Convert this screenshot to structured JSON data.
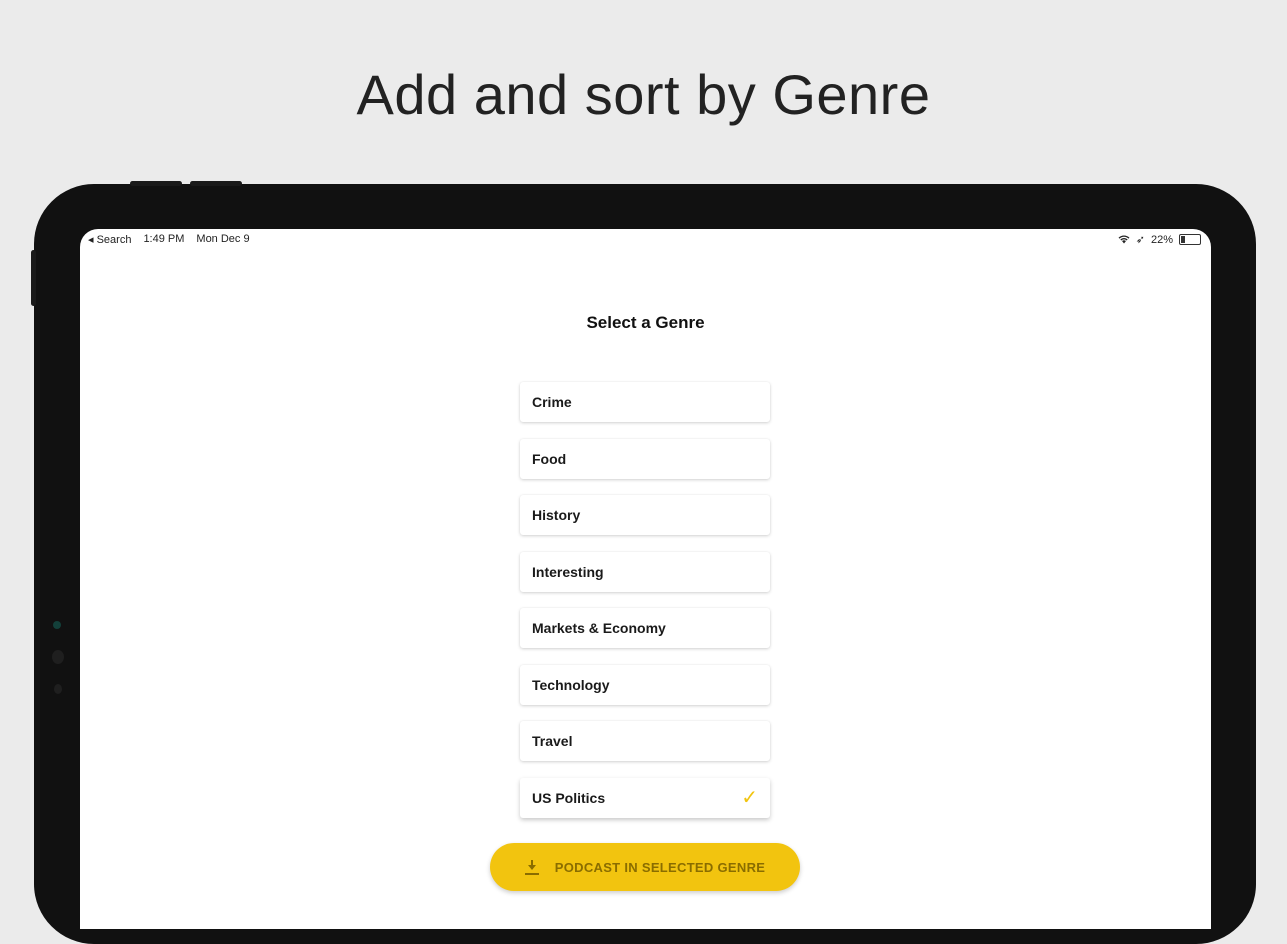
{
  "headline": "Add and sort by Genre",
  "status_bar": {
    "back": "◂ Search",
    "time": "1:49 PM",
    "date": "Mon Dec 9",
    "battery": "22%",
    "battery_level": 0.22
  },
  "screen_title": "Select a Genre",
  "genres": [
    {
      "label": "Crime",
      "selected": false
    },
    {
      "label": "Food",
      "selected": false
    },
    {
      "label": "History",
      "selected": false
    },
    {
      "label": "Interesting",
      "selected": false
    },
    {
      "label": "Markets & Economy",
      "selected": false
    },
    {
      "label": "Technology",
      "selected": false
    },
    {
      "label": "Travel",
      "selected": false
    },
    {
      "label": "US Politics",
      "selected": true
    }
  ],
  "check_mark": "✓",
  "cta_label": "PODCAST IN SELECTED GENRE",
  "colors": {
    "accent": "#f2c40f",
    "background": "#ebebeb",
    "device": "#111111"
  }
}
